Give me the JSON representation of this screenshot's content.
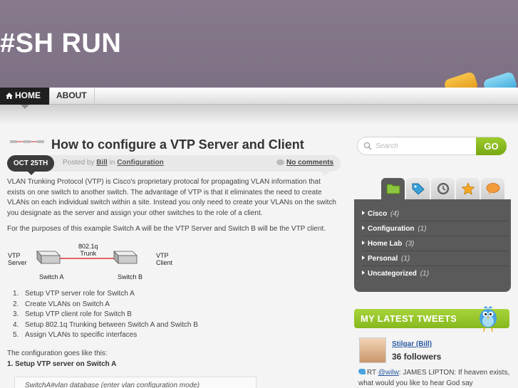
{
  "site": {
    "title": "#SH RUN",
    "colors": {
      "header": "#7d7084",
      "accent": "#86b81d",
      "dark": "#3b3b3b"
    }
  },
  "nav": {
    "items": [
      {
        "label": "HOME",
        "icon": "home-icon",
        "active": true
      },
      {
        "label": "ABOUT",
        "active": false
      }
    ]
  },
  "post": {
    "title": "How to configure a VTP Server and Client",
    "date": "OCT 25TH",
    "posted_by_prefix": "Posted by",
    "author": "Bill",
    "in_word": "in",
    "category": "Configuration",
    "comments": "No comments",
    "paragraph1": "VLAN Trunking Protocol (VTP) is Cisco's proprietary protocal for propagating VLAN information that exists on one switch to another switch.  The advantage of VTP is that it eliminates the need to create VLANs on each individual switch within a site.  Instead you only need to create your VLANs on the switch you designate as the server and assign your other switches to the role of a client.",
    "paragraph2": "For the purposes of this example Switch A will be the VTP Server and Switch B will be the VTP client.",
    "diagram": {
      "left_label": "VTP\nServer",
      "link_label": "802.1q\nTrunk",
      "right_label": "VTP\nClient",
      "switch_a": "Switch A",
      "switch_b": "Switch B"
    },
    "steps": [
      "Setup VTP server role for Switch A",
      "Create VLANs on Switch A",
      "Setup VTP client role for Switch B",
      "Setup 802.1q Trunking between Switch A and Switch B",
      "Assign VLANs to specific interfaces"
    ],
    "config_intro": "The configuration goes like this:",
    "config_heading": "1. Setup VTP server on Switch A",
    "code_line": "SwitchA#vlan database (enter vlan configuration mode)"
  },
  "sidebar": {
    "search": {
      "placeholder": "Search",
      "button": "GO"
    },
    "tabs": [
      "folder-icon",
      "tag-icon",
      "clock-icon",
      "star-icon",
      "comment-icon"
    ],
    "categories": [
      {
        "name": "Cisco",
        "count": "(4)"
      },
      {
        "name": "Configuration",
        "count": "(1)"
      },
      {
        "name": "Home Lab",
        "count": "(3)"
      },
      {
        "name": "Personal",
        "count": "(1)"
      },
      {
        "name": "Uncategorized",
        "count": "(1)"
      }
    ],
    "tweets": {
      "title": "MY LATEST TWEETS",
      "user": "Stilgar (Bill)",
      "followers": "36 followers",
      "tweet_prefix": "RT",
      "tweet_handle": "@wilw",
      "tweet_text": ": JAMES LIPTON: If heaven exists, what would you like to hear God say"
    }
  }
}
